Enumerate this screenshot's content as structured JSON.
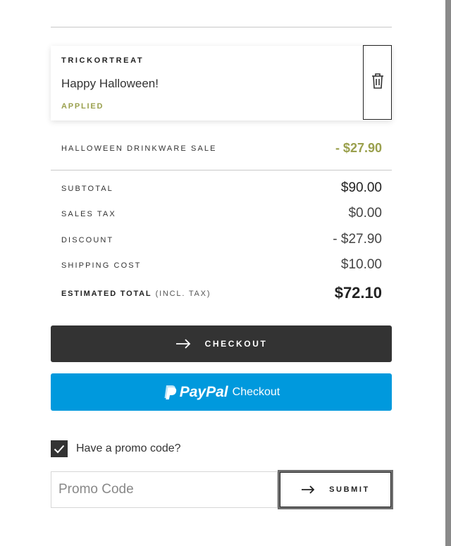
{
  "coupon": {
    "code": "TRICKORTREAT",
    "description": "Happy Halloween!",
    "status": "APPLIED",
    "remove_icon": "trash-icon"
  },
  "promotion": {
    "label": "HALLOWEEN DRINKWARE SALE",
    "amount": "- $27.90"
  },
  "summary": {
    "subtotal_label": "SUBTOTAL",
    "subtotal_value": "$90.00",
    "sales_tax_label": "SALES TAX",
    "sales_tax_value": "$0.00",
    "discount_label": "DISCOUNT",
    "discount_value": "- $27.90",
    "shipping_label": "SHIPPING COST",
    "shipping_value": "$10.00",
    "total_label": "ESTIMATED TOTAL",
    "total_label_suffix": "(INCL. TAX)",
    "total_value": "$72.10"
  },
  "checkout": {
    "label": "CHECKOUT",
    "icon": "arrow-right-icon"
  },
  "paypal": {
    "brand": "PayPal",
    "label": "Checkout",
    "icon": "paypal-logo-icon"
  },
  "promo": {
    "toggle_label": "Have a promo code?",
    "checked": true,
    "input_value": "",
    "input_placeholder": "Promo Code",
    "submit_label": "SUBMIT",
    "submit_icon": "arrow-right-icon"
  },
  "colors": {
    "accent_green": "#9aa04d",
    "dark_button": "#333333",
    "paypal_blue": "#0099dd",
    "text": "#333333"
  }
}
